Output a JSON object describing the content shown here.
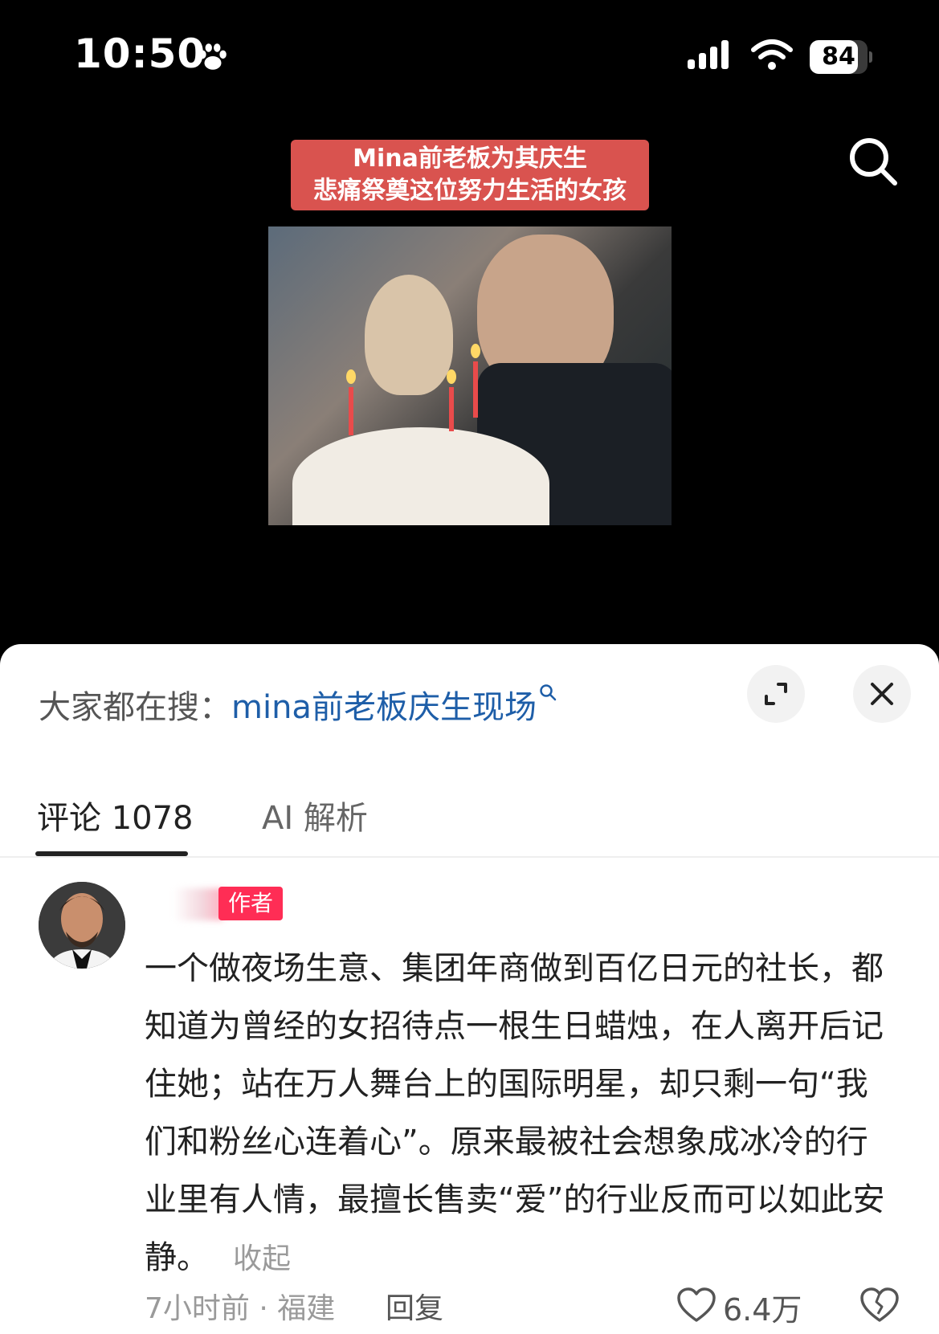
{
  "status_bar": {
    "time": "10:50",
    "battery": "84",
    "battery_level": 0.84
  },
  "video": {
    "caption_line1": "Mina前老板为其庆生",
    "caption_line2": "悲痛祭奠这位努力生活的女孩",
    "caption_bg": "#d9534f"
  },
  "sheet": {
    "trending_prefix": "大家都在搜：",
    "trending_query": "mina前老板庆生现场",
    "link_color": "#1e5ea8"
  },
  "tabs": {
    "comments_label": "评论 1078",
    "ai_label": "AI 解析"
  },
  "comment": {
    "badge": "作者",
    "badge_color": "#ff2d55",
    "text": "一个做夜场生意、集团年商做到百亿日元的社长，都知道为曾经的女招待点一根生日蜡烛，在人离开后记住她；站在万人舞台上的国际明星，却只剩一句“我们和粉丝心连着心”。原来最被社会想象成冰冷的行业里有人情，最擅长售卖“爱”的行业反而可以如此安静。",
    "collapse_label": "收起",
    "meta": "7小时前 · 福建",
    "reply_label": "回复",
    "like_count": "6.4万"
  }
}
